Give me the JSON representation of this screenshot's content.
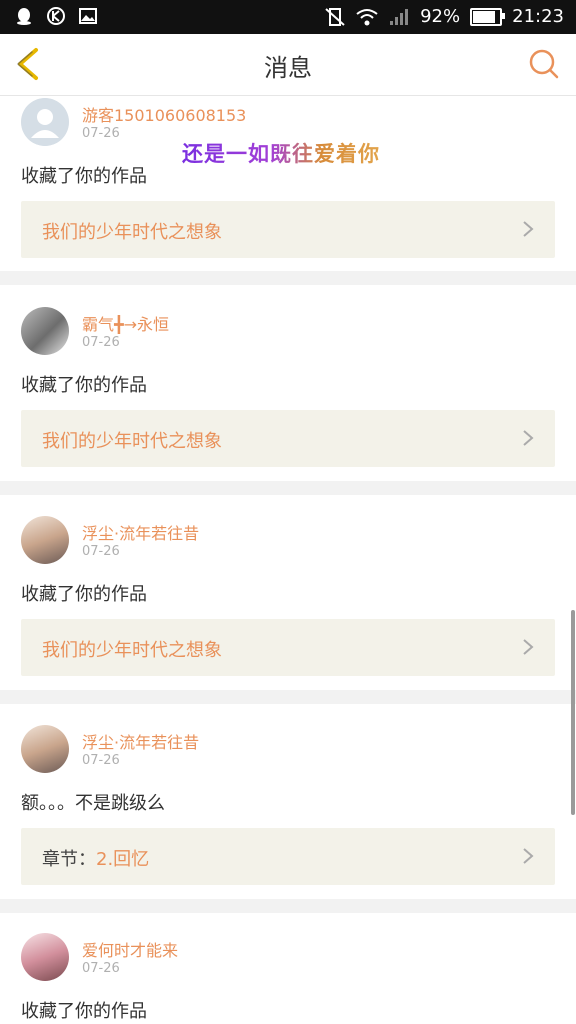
{
  "status_bar": {
    "battery_percent": "92%",
    "time": "21:23",
    "battery_level": 0.92,
    "icons_left": [
      "qq-icon",
      "k-icon",
      "image-icon"
    ],
    "icons_right": [
      "vibrate-off-icon",
      "wifi-icon",
      "signal-icon",
      "battery-icon"
    ]
  },
  "header": {
    "title": "消息",
    "back_icon": "chevron-left-icon",
    "search_icon": "search-icon"
  },
  "overlay_text": "还是一如既往爱着你",
  "messages": [
    {
      "username": "游客1501060608153",
      "date": "07-26",
      "text": "收藏了你的作品",
      "ref_prefix": "",
      "ref_title": "我们的少年时代之想象"
    },
    {
      "username": "霸气╋→永恒",
      "date": "07-26",
      "text": "收藏了你的作品",
      "ref_prefix": "",
      "ref_title": "我们的少年时代之想象"
    },
    {
      "username": "浮尘·流年若往昔",
      "date": "07-26",
      "text": "收藏了你的作品",
      "ref_prefix": "",
      "ref_title": "我们的少年时代之想象"
    },
    {
      "username": "浮尘·流年若往昔",
      "date": "07-26",
      "text": "额。。。不是跳级么",
      "ref_prefix": "章节：",
      "ref_title": "2.回忆"
    },
    {
      "username": "爱何时才能来",
      "date": "07-26",
      "text": "收藏了你的作品"
    }
  ],
  "colors": {
    "accent": "#e9915a",
    "ref_bg": "#f3f2e9",
    "back_icon": "#e7b800"
  }
}
